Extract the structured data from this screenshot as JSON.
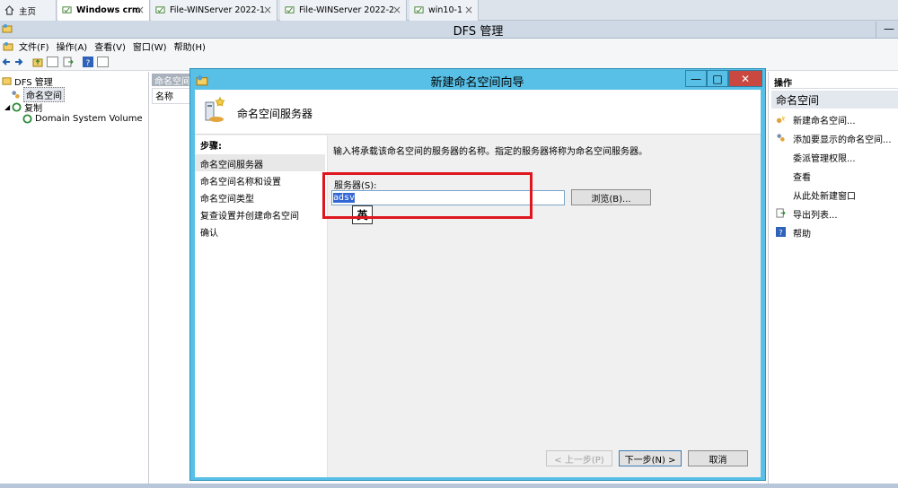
{
  "browser_tabs": [
    {
      "label": "主页",
      "icon": "home-icon"
    },
    {
      "label": "Windows crm",
      "icon": "vm-icon",
      "active": true
    },
    {
      "label": "File-WINServer 2022-1",
      "icon": "vm-icon"
    },
    {
      "label": "File-WINServer 2022-2",
      "icon": "vm-icon"
    },
    {
      "label": "win10-1",
      "icon": "vm-icon"
    }
  ],
  "app": {
    "title": "DFS 管理",
    "minimize_glyph": "—"
  },
  "menu": [
    "文件(F)",
    "操作(A)",
    "查看(V)",
    "窗口(W)",
    "帮助(H)"
  ],
  "tree": {
    "root": "DFS 管理",
    "namespace": "命名空间",
    "replication": "复制",
    "child": "Domain System Volume"
  },
  "middle": {
    "header": "命名空间",
    "column": "名称"
  },
  "actions": {
    "title": "操作",
    "section": "命名空间",
    "items": [
      {
        "label": "新建命名空间...",
        "icon": "new-namespace-icon"
      },
      {
        "label": "添加要显示的命名空间...",
        "icon": "add-namespace-icon"
      },
      {
        "label": "委派管理权限...",
        "icon": ""
      },
      {
        "label": "查看",
        "icon": ""
      },
      {
        "label": "从此处新建窗口",
        "icon": ""
      },
      {
        "label": "导出列表...",
        "icon": "export-icon"
      },
      {
        "label": "帮助",
        "icon": "help-icon"
      }
    ]
  },
  "wizard": {
    "title": "新建命名空间向导",
    "header": "命名空间服务器",
    "steps_title": "步骤:",
    "steps": [
      "命名空间服务器",
      "命名空间名称和设置",
      "命名空间类型",
      "复查设置并创建命名空间",
      "确认"
    ],
    "active_step": 0,
    "instruction": "输入将承载该命名空间的服务器的名称。指定的服务器将称为命名空间服务器。",
    "server_label": "服务器(S):",
    "server_value": "adsv",
    "browse": "浏览(B)...",
    "ime": "英",
    "prev": "< 上一步(P)",
    "next": "下一步(N) >",
    "cancel": "取消",
    "close_glyph": "✕",
    "max_glyph": "□",
    "min_glyph": "—"
  }
}
